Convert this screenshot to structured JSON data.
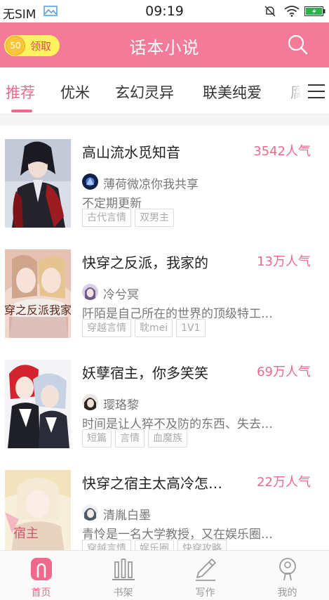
{
  "status_bar": {
    "carrier": "无SIM",
    "time": "09:19"
  },
  "app_bar": {
    "title": "话本小说",
    "coin_count": "50",
    "coin_action": "领取",
    "colors": {
      "bar": "#f37a98",
      "badge": "#fff45e",
      "accent": "#f0698c"
    }
  },
  "tabs": [
    {
      "label": "推荐",
      "active": true
    },
    {
      "label": "优米"
    },
    {
      "label": "玄幻灵异"
    },
    {
      "label": "联美纯爱"
    },
    {
      "label": "腐"
    }
  ],
  "tab_menu_icon": "menu-icon",
  "books": [
    {
      "title": "高山流水觅知音",
      "popularity": "3542人气",
      "author": "薄荷微凉你我共享",
      "description": "不定期更新",
      "tags": [
        "古代言情",
        "双男主"
      ]
    },
    {
      "title": "快穿之反派，我家的",
      "popularity": "13万人气",
      "author": "冷兮冥",
      "description": "阡陌是自己所在的世界的顶级特工…",
      "tags": [
        "穿越言情",
        "耽mei",
        "1V1"
      ],
      "cover_text": "快穿之反派我家的"
    },
    {
      "title": "妖孽宿主，你多笑笑",
      "popularity": "69万人气",
      "author": "璎珞黎",
      "description": "时间是让人猝不及防的东西、失去…",
      "tags": [
        "短篇",
        "言情",
        "血魔族"
      ]
    },
    {
      "title": "快穿之宿主太高冷怎…",
      "popularity": "22万人气",
      "author": "清胤白墨",
      "description": "青怜是一名大学教授，又在娱乐圈…",
      "tags": [
        "穿越言情",
        "娱乐圈",
        "快穿攻略"
      ],
      "cover_text": "宿主"
    }
  ],
  "bottom_nav": [
    {
      "label": "首页",
      "icon": "home-icon",
      "active": true
    },
    {
      "label": "书架",
      "icon": "bookshelf-icon"
    },
    {
      "label": "写作",
      "icon": "pen-icon"
    },
    {
      "label": "我的",
      "icon": "profile-icon"
    }
  ]
}
